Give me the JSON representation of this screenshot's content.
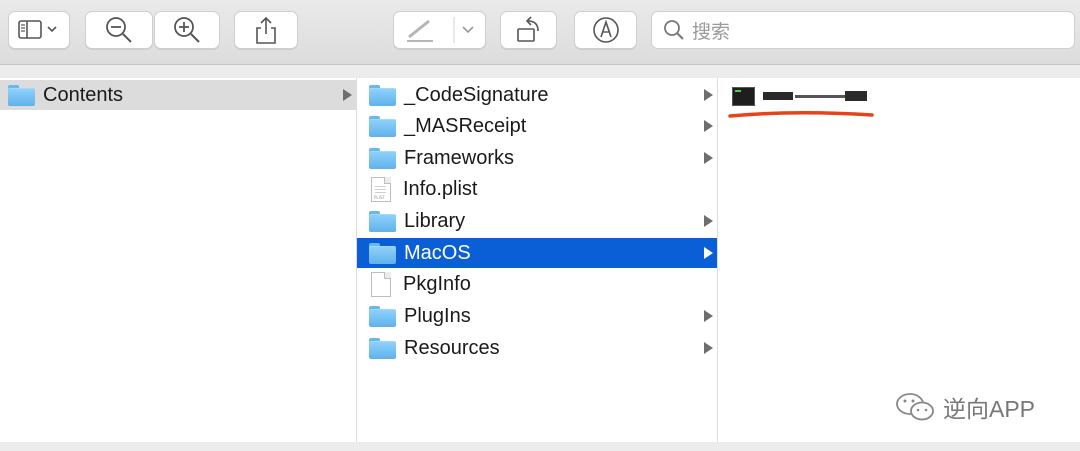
{
  "toolbar": {
    "buttons": [
      {
        "name": "sidebar-toggle-button",
        "icon": "sidebar-icon"
      },
      {
        "name": "zoom-out-button",
        "icon": "zoom-out-icon"
      },
      {
        "name": "zoom-in-button",
        "icon": "zoom-in-icon"
      },
      {
        "name": "share-button",
        "icon": "share-icon"
      },
      {
        "name": "markup-button",
        "icon": "pen-icon"
      },
      {
        "name": "rotate-button",
        "icon": "rotate-icon"
      },
      {
        "name": "annotate-button",
        "icon": "pen-circle-icon"
      }
    ],
    "search_placeholder": "搜索"
  },
  "columns": [
    {
      "items": [
        {
          "name": "Contents",
          "kind": "folder",
          "has_children": true,
          "selected": "inactive"
        }
      ]
    },
    {
      "items": [
        {
          "name": "_CodeSignature",
          "kind": "folder",
          "has_children": true
        },
        {
          "name": "_MASReceipt",
          "kind": "folder",
          "has_children": true
        },
        {
          "name": "Frameworks",
          "kind": "folder",
          "has_children": true
        },
        {
          "name": "Info.plist",
          "kind": "plist",
          "has_children": false
        },
        {
          "name": "Library",
          "kind": "folder",
          "has_children": true
        },
        {
          "name": "MacOS",
          "kind": "folder",
          "has_children": true,
          "selected": "active"
        },
        {
          "name": "PkgInfo",
          "kind": "file",
          "has_children": false
        },
        {
          "name": "PlugIns",
          "kind": "folder",
          "has_children": true
        },
        {
          "name": "Resources",
          "kind": "folder",
          "has_children": true
        }
      ]
    },
    {
      "items": [
        {
          "kind": "executable",
          "redacted": true
        }
      ]
    }
  ],
  "watermark": {
    "text": "逆向APP",
    "icon": "wechat-icon"
  },
  "colors": {
    "selection": "#0a5fd7",
    "folder": "#5fb2eb",
    "underline": "#e8421c"
  }
}
